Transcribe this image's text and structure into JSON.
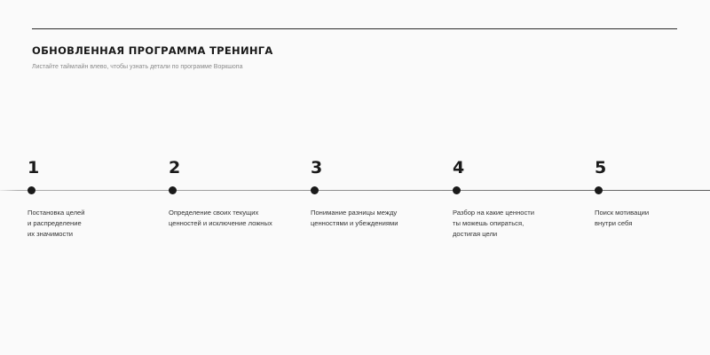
{
  "header": {
    "title": "ОБНОВЛЕННАЯ ПРОГРАММА ТРЕНИНГА",
    "subtitle": "Листайте таймлайн влево, чтобы узнать детали по программе Воркшопа"
  },
  "timeline": {
    "steps": [
      {
        "number": "1",
        "text": "Постановка целей\nи распределение\nих значимости"
      },
      {
        "number": "2",
        "text": "Определение своих текущих\nценностей и исключение ложных"
      },
      {
        "number": "3",
        "text": "Понимание разницы между\nценностями и убеждениями"
      },
      {
        "number": "4",
        "text": "Разбор на какие ценности\nты можешь опираться,\nдостигая цели"
      },
      {
        "number": "5",
        "text": "Поиск мотивации\nвнутри себя"
      }
    ]
  }
}
